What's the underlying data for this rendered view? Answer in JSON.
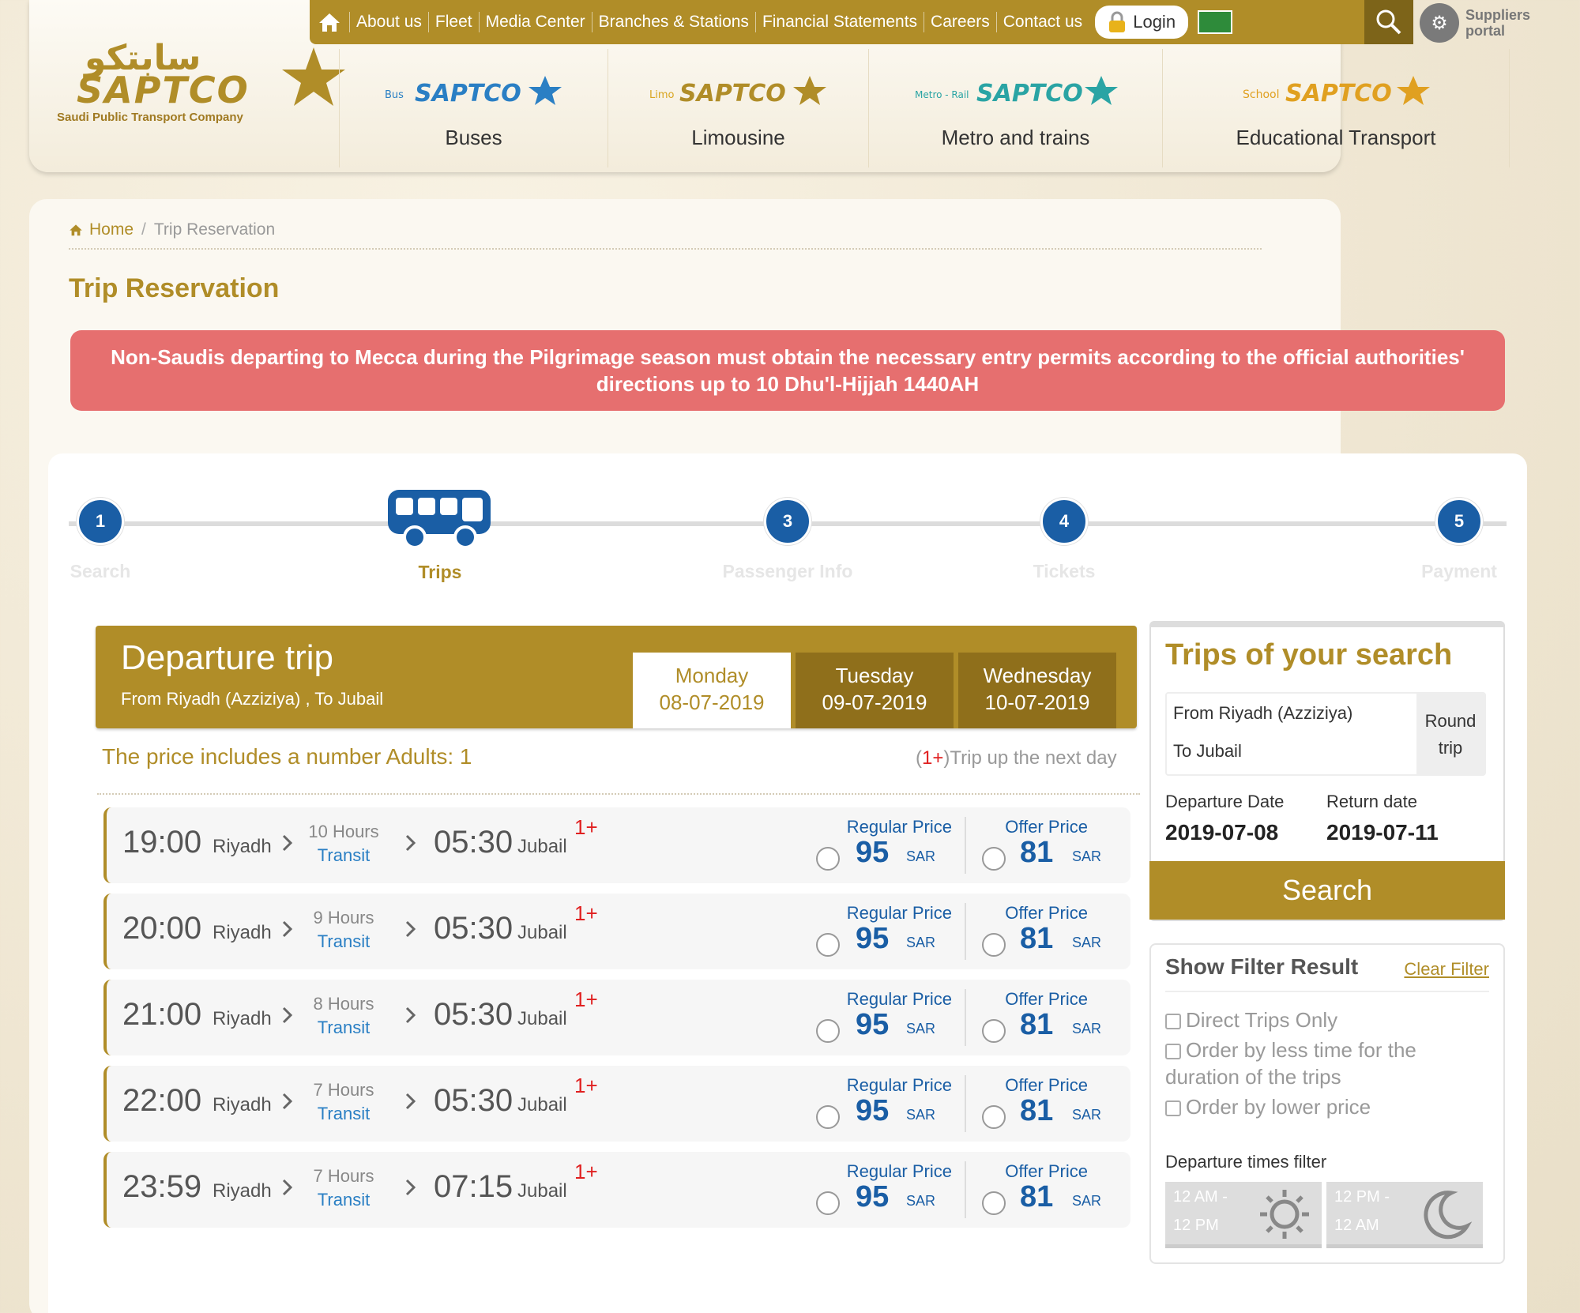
{
  "brand": {
    "name_arabic": "سابتكو",
    "name_latin": "SAPTCO",
    "tagline": "Saudi Public Transport Company",
    "gold": "#b08d28",
    "blue": "#1a5ea5"
  },
  "topnav": {
    "items": [
      "About us",
      "Fleet",
      "Media Center",
      "Branches & Stations",
      "Financial Statements",
      "Careers",
      "Contact us"
    ],
    "login": "Login",
    "suppliers_line1": "Suppliers",
    "suppliers_line2": "portal"
  },
  "services": [
    {
      "tag": "Bus",
      "label": "Buses"
    },
    {
      "tag": "Limo",
      "label": "Limousine"
    },
    {
      "tag": "Metro - Rail",
      "label": "Metro and trains"
    },
    {
      "tag": "School",
      "label": "Educational Transport"
    }
  ],
  "breadcrumb": {
    "home": "Home",
    "separator": "/",
    "current": "Trip Reservation"
  },
  "page_title": "Trip Reservation",
  "alert": "Non-Saudis departing to Mecca during the Pilgrimage season must obtain the necessary entry permits according to the official authorities' directions up to 10 Dhu'l-Hijjah 1440AH",
  "steps": [
    {
      "num": "1",
      "label": "Search"
    },
    {
      "num": "",
      "label": "Trips"
    },
    {
      "num": "3",
      "label": "Passenger Info"
    },
    {
      "num": "4",
      "label": "Tickets"
    },
    {
      "num": "5",
      "label": "Payment"
    }
  ],
  "departure": {
    "title": "Departure trip",
    "route": "From Riyadh (Azziziya) , To Jubail",
    "days": [
      {
        "day": "Monday",
        "date": "08-07-2019"
      },
      {
        "day": "Tuesday",
        "date": "09-07-2019"
      },
      {
        "day": "Wednesday",
        "date": "10-07-2019"
      }
    ],
    "price_note": "The price includes a number Adults: 1",
    "next_day_plus": "1+",
    "next_day_text": "Trip up the next day"
  },
  "trip_labels": {
    "transit": "Transit",
    "regular": "Regular Price",
    "offer": "Offer Price",
    "currency": "SAR",
    "next_day": "1+"
  },
  "trips": [
    {
      "dep": "19:00",
      "from": "Riyadh",
      "hours": "10 Hours",
      "arr": "05:30",
      "to": "Jubail",
      "regular": "95",
      "offer": "81"
    },
    {
      "dep": "20:00",
      "from": "Riyadh",
      "hours": "9 Hours",
      "arr": "05:30",
      "to": "Jubail",
      "regular": "95",
      "offer": "81"
    },
    {
      "dep": "21:00",
      "from": "Riyadh",
      "hours": "8 Hours",
      "arr": "05:30",
      "to": "Jubail",
      "regular": "95",
      "offer": "81"
    },
    {
      "dep": "22:00",
      "from": "Riyadh",
      "hours": "7 Hours",
      "arr": "05:30",
      "to": "Jubail",
      "regular": "95",
      "offer": "81"
    },
    {
      "dep": "23:59",
      "from": "Riyadh",
      "hours": "7 Hours",
      "arr": "07:15",
      "to": "Jubail",
      "regular": "95",
      "offer": "81"
    }
  ],
  "side_search": {
    "title": "Trips of your search",
    "from": "From Riyadh (Azziziya)",
    "to": "To Jubail",
    "trip_type_line1": "Round",
    "trip_type_line2": "trip",
    "departure_label": "Departure Date",
    "departure_value": "2019-07-08",
    "return_label": "Return date",
    "return_value": "2019-07-11",
    "search_button": "Search"
  },
  "filter": {
    "title": "Show Filter Result",
    "clear": "Clear Filter",
    "options": [
      "Direct Trips Only",
      "Order by less time for the duration of the trips",
      "Order by lower price"
    ],
    "departure_times_label": "Departure times filter",
    "slot_am_from": "12 AM -",
    "slot_am_to": "12 PM",
    "slot_pm_from": "12 PM -",
    "slot_pm_to": "12 AM"
  }
}
